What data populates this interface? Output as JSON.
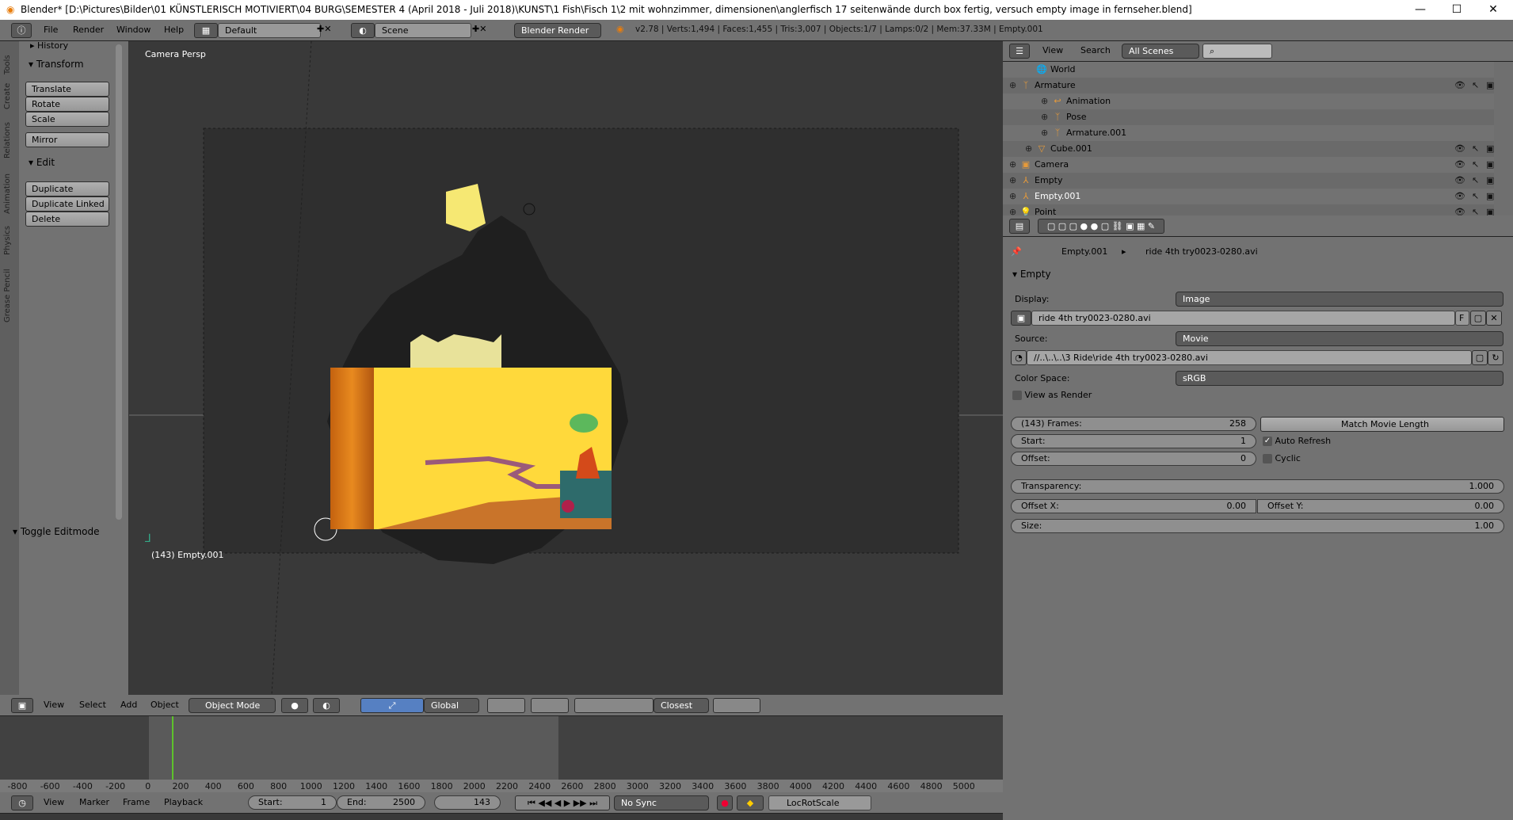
{
  "window": {
    "title": "Blender* [D:\\Pictures\\Bilder\\01 KÜNSTLERISCH MOTIVIERT\\04 BURG\\SEMESTER 4 (April 2018 - Juli 2018)\\KUNST\\1 Fish\\Fisch 1\\2 mit wohnzimmer, dimensionen\\anglerfisch 17 seitenwände durch box fertig, versuch empty image in fernseher.blend]",
    "minimize": "—",
    "maximize": "☐",
    "close": "✕"
  },
  "info_header": {
    "menus": [
      "File",
      "Render",
      "Window",
      "Help"
    ],
    "layout": "Default",
    "scene": "Scene",
    "engine": "Blender Render",
    "stats": "v2.78 | Verts:1,494 | Faces:1,455 | Tris:3,007 | Objects:1/7 | Lamps:0/2 | Mem:37.33M | Empty.001"
  },
  "toolshelf": {
    "tabs": [
      "Tools",
      "Create",
      "Relations",
      "Animation",
      "Physics",
      "Grease Pencil"
    ],
    "history": "History",
    "transform": "Transform",
    "transform_buttons": [
      "Translate",
      "Rotate",
      "Scale",
      "Mirror"
    ],
    "edit": "Edit",
    "edit_buttons": [
      "Duplicate",
      "Duplicate Linked",
      "Delete"
    ],
    "toggle_editmode": "Toggle Editmode"
  },
  "viewport": {
    "view_name": "Camera Persp",
    "object_label": "(143) Empty.001",
    "accent": "#ffd93b"
  },
  "viewport_header": {
    "menus": [
      "View",
      "Select",
      "Add",
      "Object"
    ],
    "mode": "Object Mode",
    "orientation": "Global",
    "snap": "Closest"
  },
  "timeline": {
    "ticks": [
      "-800",
      "-600",
      "-400",
      "-200",
      "0",
      "200",
      "400",
      "600",
      "800",
      "1000",
      "1200",
      "1400",
      "1600",
      "1800",
      "2000",
      "2200",
      "2400",
      "2600",
      "2800",
      "3000",
      "3200",
      "3400",
      "3600",
      "3800",
      "4000",
      "4200",
      "4400",
      "4600",
      "4800",
      "5000"
    ],
    "current_frame_color": "#5ec22b"
  },
  "timeline_header": {
    "menus": [
      "View",
      "Marker",
      "Frame",
      "Playback"
    ],
    "start_label": "Start:",
    "start": "1",
    "end_label": "End:",
    "end": "2500",
    "current": "143",
    "sync": "No Sync",
    "keying_set": "LocRotScale"
  },
  "outliner": {
    "menus": [
      "View",
      "Search"
    ],
    "filter": "All Scenes",
    "items": [
      {
        "label": "World",
        "icon": "world",
        "indent": 1
      },
      {
        "label": "Armature",
        "icon": "armature",
        "indent": 0,
        "vis": true
      },
      {
        "label": "Animation",
        "icon": "action",
        "indent": 2
      },
      {
        "label": "Pose",
        "icon": "pose",
        "indent": 2
      },
      {
        "label": "Armature.001",
        "icon": "armature-data",
        "indent": 2
      },
      {
        "label": "Cube.001",
        "icon": "mesh",
        "indent": 1,
        "vis": true
      },
      {
        "label": "Camera",
        "icon": "camera",
        "indent": 0,
        "vis": true
      },
      {
        "label": "Empty",
        "icon": "empty",
        "indent": 0,
        "vis": true
      },
      {
        "label": "Empty.001",
        "icon": "empty",
        "indent": 0,
        "vis": true,
        "active": true
      },
      {
        "label": "Point",
        "icon": "lamp",
        "indent": 0,
        "vis": true
      }
    ]
  },
  "properties": {
    "breadcrumb": [
      "Empty.001",
      "ride 4th try0023-0280.avi"
    ],
    "panel": "Empty",
    "display_label": "Display:",
    "display": "Image",
    "image": "ride 4th try0023-0280.avi",
    "image_flag": "F",
    "source_label": "Source:",
    "source": "Movie",
    "path": "//..\\..\\..\\3 Ride\\ride 4th try0023-0280.avi",
    "colorspace_label": "Color Space:",
    "colorspace": "sRGB",
    "view_as_render": "View as Render",
    "frames_label": "(143) Frames:",
    "frames": "258",
    "match": "Match Movie Length",
    "start_label": "Start:",
    "start": "1",
    "auto_refresh": "Auto Refresh",
    "offset_label": "Offset:",
    "offset": "0",
    "cyclic": "Cyclic",
    "transparency_label": "Transparency:",
    "transparency": "1.000",
    "offset_x_label": "Offset X:",
    "offset_x": "0.00",
    "offset_y_label": "Offset Y:",
    "offset_y": "0.00",
    "size_label": "Size:",
    "size": "1.00"
  }
}
